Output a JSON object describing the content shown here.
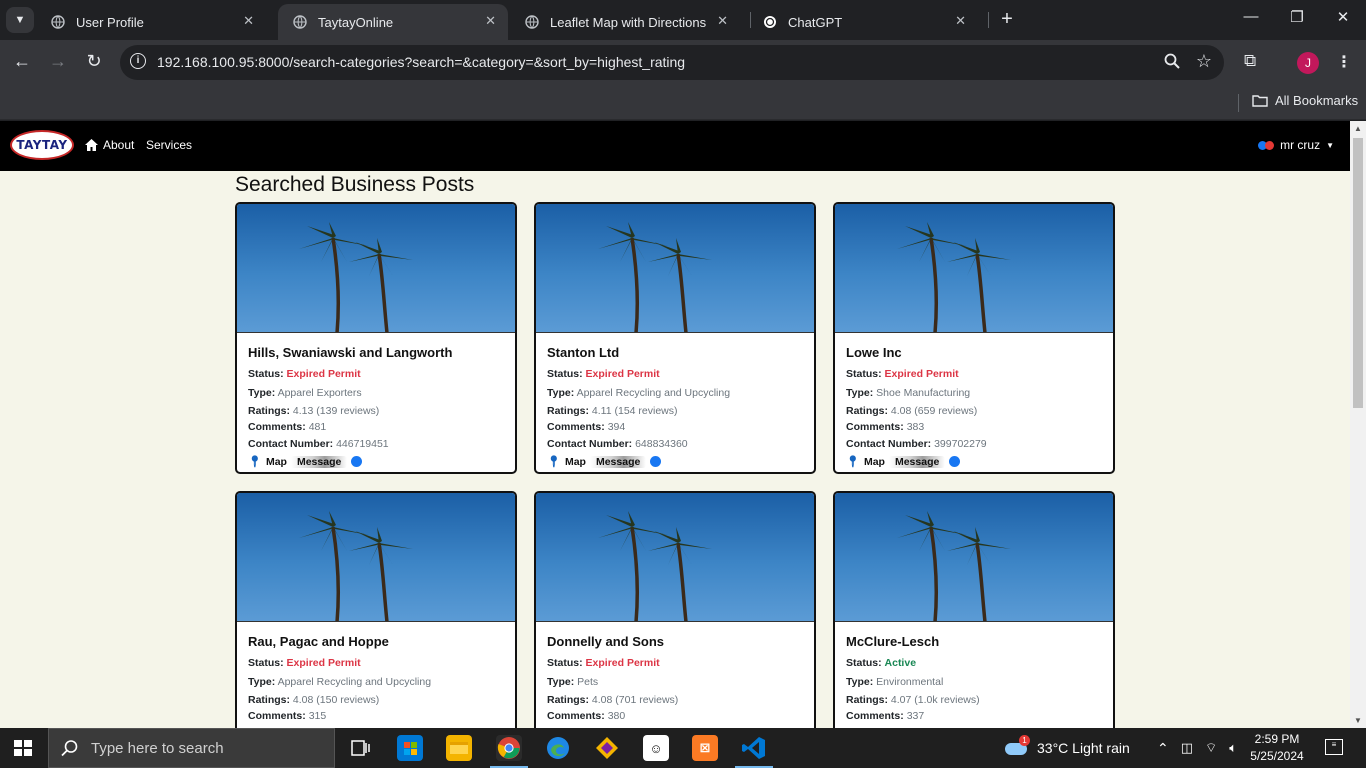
{
  "browser": {
    "tabs": [
      {
        "title": "User Profile",
        "active": false
      },
      {
        "title": "TaytayOnline",
        "active": true
      },
      {
        "title": "Leaflet Map with Directions",
        "active": false
      },
      {
        "title": "ChatGPT",
        "active": false
      }
    ],
    "url": "192.168.100.95:8000/search-categories?search=&category=&sort_by=highest_rating",
    "profile_initial": "J",
    "bookmarks_label": "All Bookmarks"
  },
  "site": {
    "logo_text": "TAYTAY",
    "nav": {
      "about": "About",
      "services": "Services"
    },
    "user_name": "mr cruz",
    "page_title": "Searched Business Posts",
    "labels": {
      "status": "Status:",
      "type": "Type:",
      "ratings": "Ratings:",
      "comments": "Comments:",
      "contact": "Contact Number:",
      "map": "Map",
      "message": "Message"
    },
    "posts": [
      {
        "name": "Hills, Swaniawski and Langworth",
        "status": "Expired Permit",
        "type": "Apparel Exporters",
        "ratings": "4.13 (139 reviews)",
        "comments": "481",
        "contact": "446719451"
      },
      {
        "name": "Stanton Ltd",
        "status": "Expired Permit",
        "type": "Apparel Recycling and Upcycling",
        "ratings": "4.11 (154 reviews)",
        "comments": "394",
        "contact": "648834360"
      },
      {
        "name": "Lowe Inc",
        "status": "Expired Permit",
        "type": "Shoe Manufacturing",
        "ratings": "4.08 (659 reviews)",
        "comments": "383",
        "contact": "399702279"
      },
      {
        "name": "Rau, Pagac and Hoppe",
        "status": "Expired Permit",
        "type": "Apparel Recycling and Upcycling",
        "ratings": "4.08 (150 reviews)",
        "comments": "315",
        "contact": ""
      },
      {
        "name": "Donnelly and Sons",
        "status": "Expired Permit",
        "type": "Pets",
        "ratings": "4.08 (701 reviews)",
        "comments": "380",
        "contact": ""
      },
      {
        "name": "McClure-Lesch",
        "status": "Active",
        "type": "Environmental",
        "ratings": "4.07 (1.0k reviews)",
        "comments": "337",
        "contact": ""
      }
    ]
  },
  "taskbar": {
    "search_placeholder": "Type here to search",
    "weather": "33°C  Light rain",
    "time": "2:59 PM",
    "date": "5/25/2024"
  },
  "colors": {
    "page_bg": "#f5f5e9",
    "expired": "#dc3545",
    "active": "#198754",
    "navbar": "#000000"
  }
}
